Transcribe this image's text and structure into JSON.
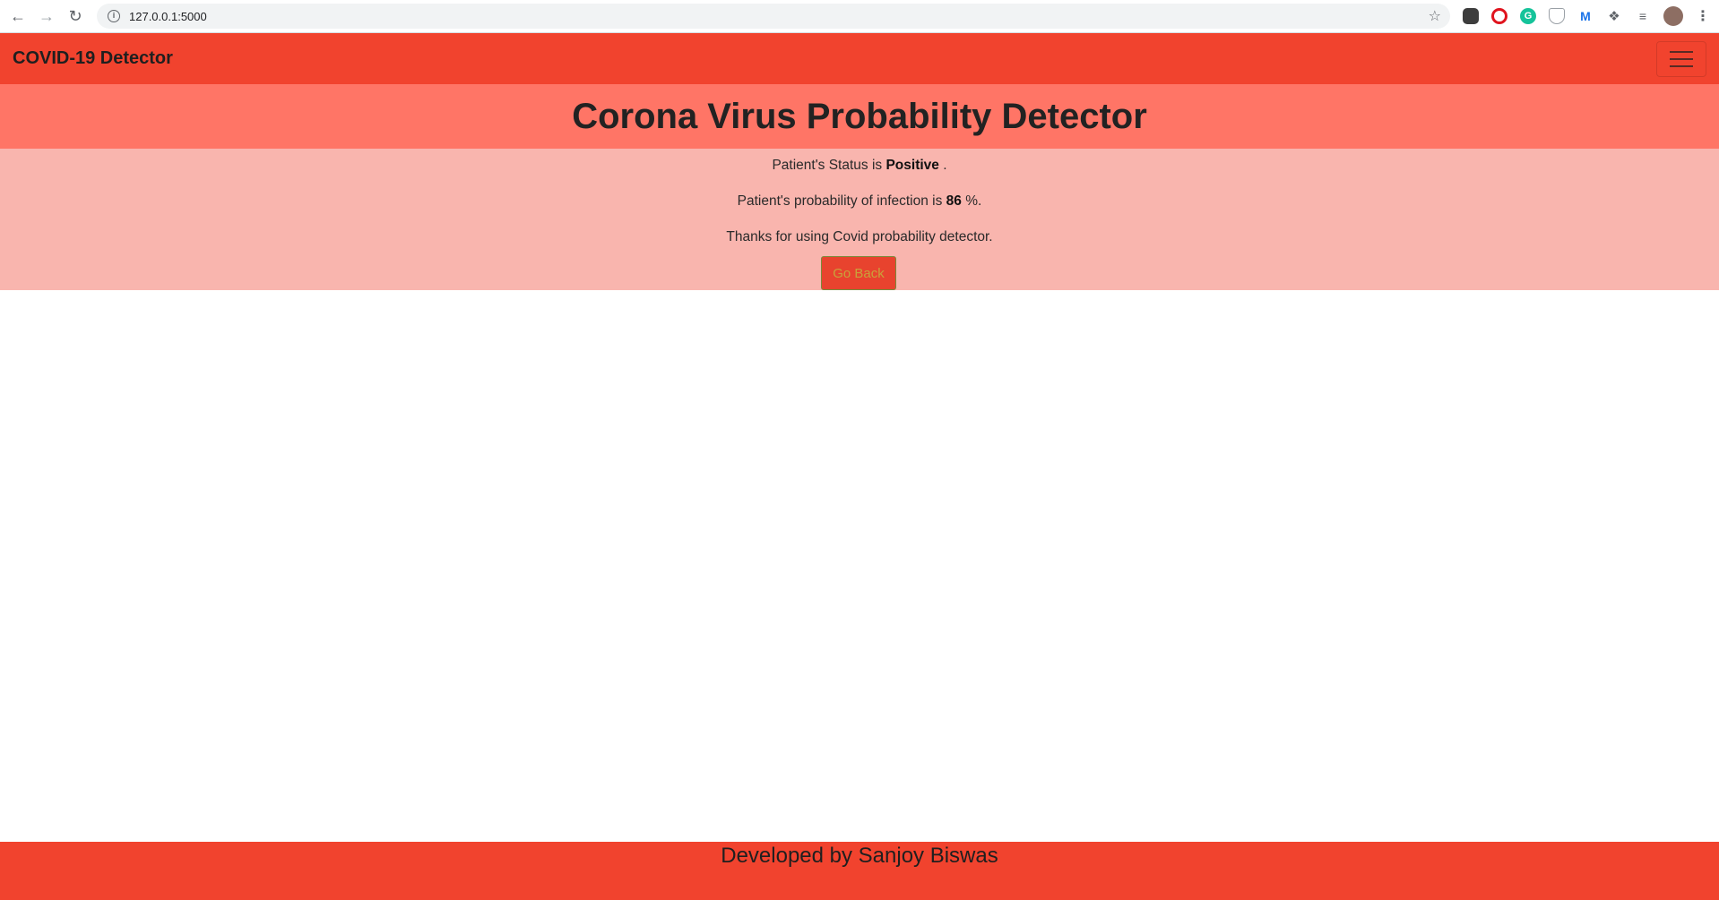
{
  "browser": {
    "url": "127.0.0.1:5000",
    "back_icon": "arrow-left-icon",
    "forward_icon": "arrow-right-icon",
    "reload_icon": "reload-icon"
  },
  "navbar": {
    "brand": "COVID-19 Detector",
    "toggle_icon": "hamburger-menu-icon"
  },
  "header": {
    "title": "Corona Virus Probability Detector"
  },
  "result": {
    "status_prefix": "Patient's Status is ",
    "status_value": "Positive",
    "status_suffix": " .",
    "prob_prefix": "Patient's probability of infection is ",
    "prob_value": "86",
    "prob_suffix": " %.",
    "thanks": "Thanks for using Covid probability detector.",
    "go_back_label": "Go Back"
  },
  "footer": {
    "text": "Developed by Sanjoy Biswas"
  },
  "colors": {
    "navbar": "#f1432e",
    "header": "#ff7566",
    "result_bg": "#f9b5ae",
    "footer": "#f1432e"
  }
}
